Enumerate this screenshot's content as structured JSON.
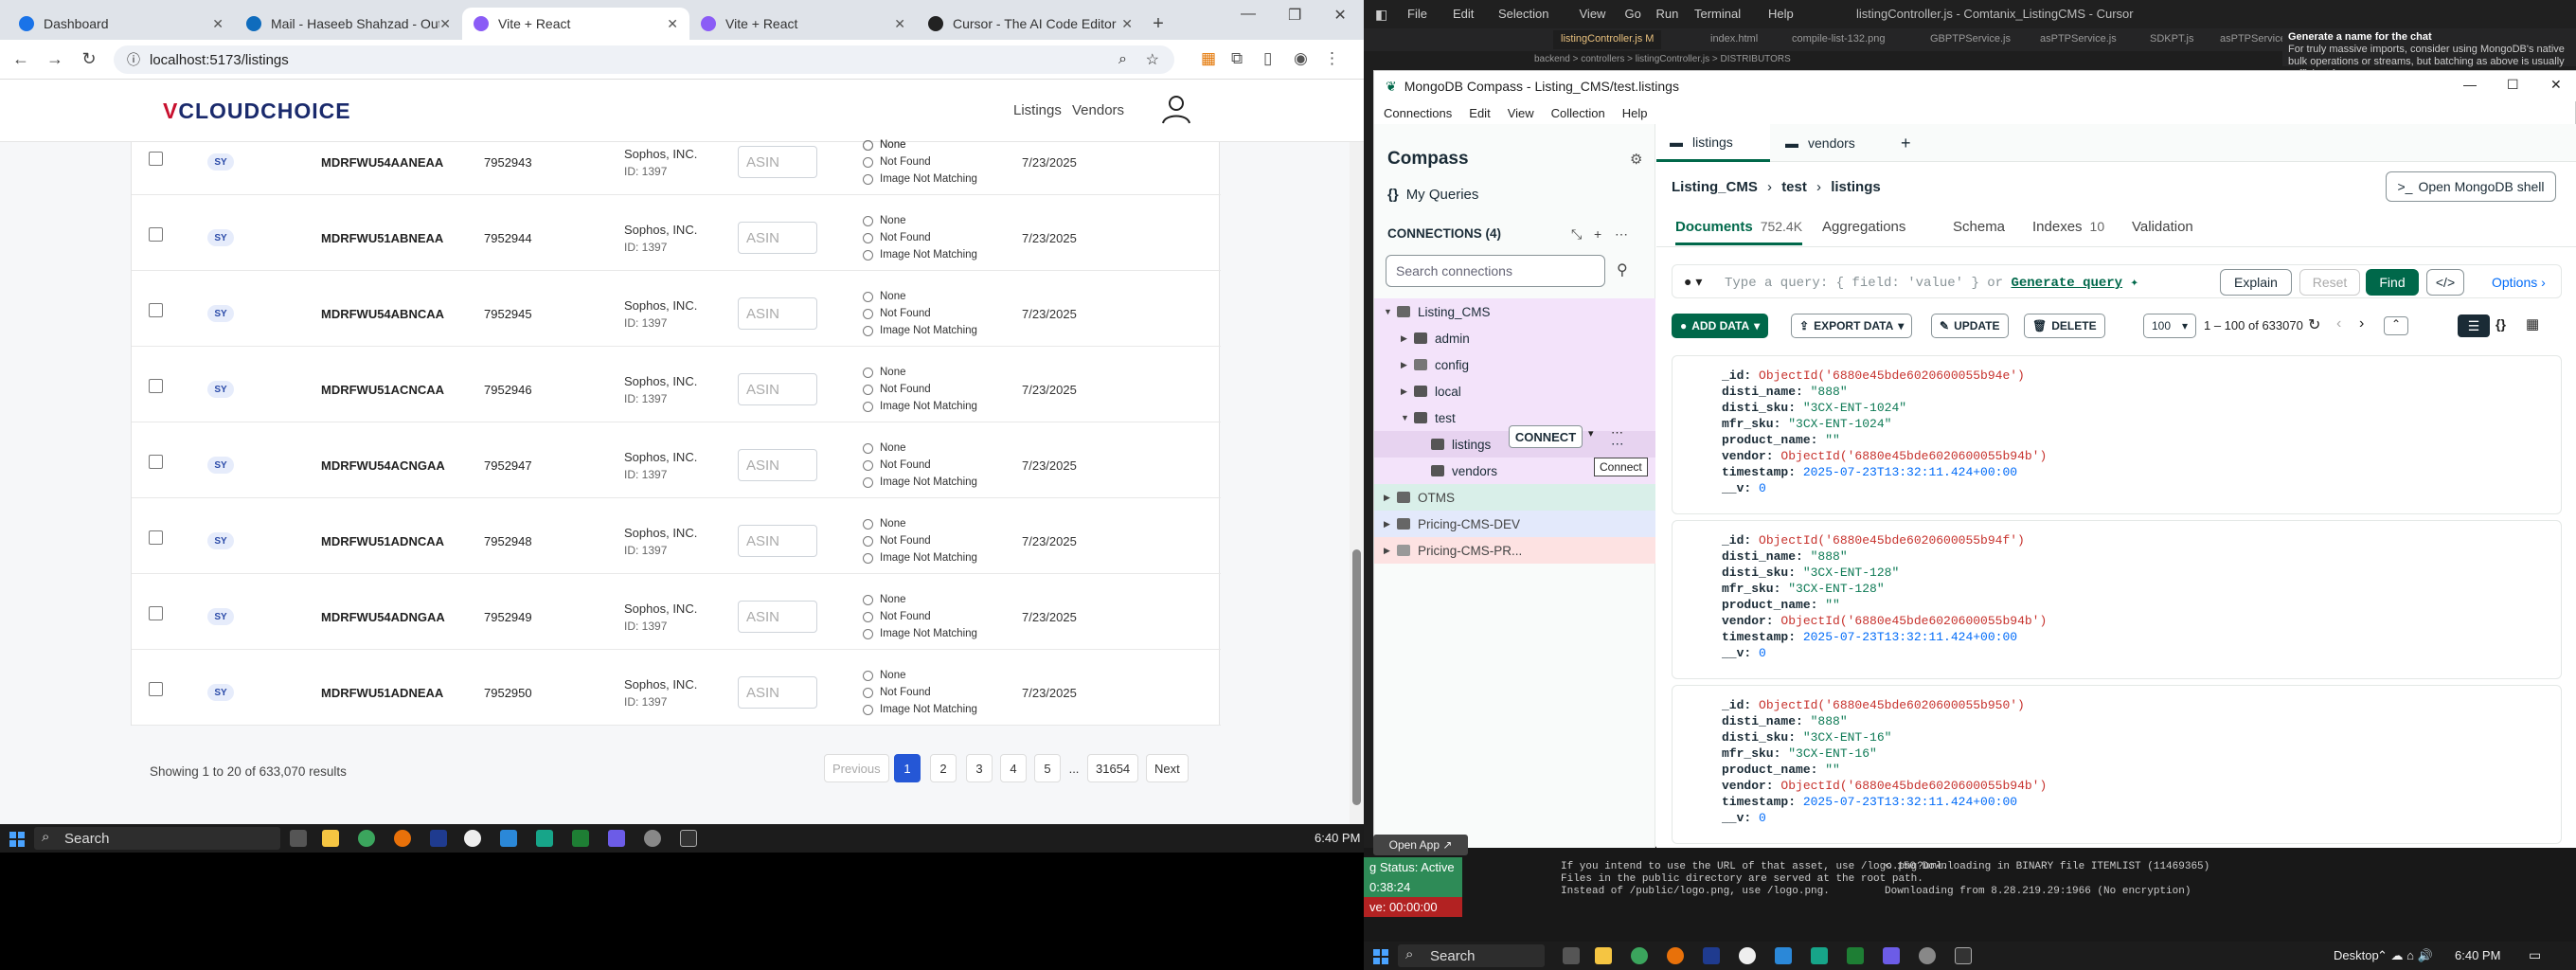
{
  "left_browser": {
    "tabs": [
      {
        "label": "Dashboard",
        "color": "#1a73e8"
      },
      {
        "label": "Mail - Haseeb Shahzad - Outlo",
        "color": "#0f6cbd"
      },
      {
        "label": "Vite + React",
        "color": "#8b5cf6"
      },
      {
        "label": "Vite + React",
        "color": "#8b5cf6"
      },
      {
        "label": "Cursor - The AI Code Editor",
        "color": "#222222"
      }
    ],
    "url": "localhost:5173/listings",
    "app": {
      "logo_prefix": "V",
      "logo_text": "CLOUDCHOICE",
      "nav": [
        "Listings",
        "Vendors"
      ]
    },
    "rows": [
      {
        "badge": "SY",
        "sku": "MDRFWU54AANEAA",
        "id": "7952943",
        "vendor": "Sophos, INC.",
        "vendor_id": "ID: 1397",
        "asin": "ASIN",
        "options": [
          "None",
          "Not Found",
          "Image Not Matching"
        ],
        "date": "7/23/2025"
      },
      {
        "badge": "SY",
        "sku": "MDRFWU51ABNEAA",
        "id": "7952944",
        "vendor": "Sophos, INC.",
        "vendor_id": "ID: 1397",
        "asin": "ASIN",
        "options": [
          "None",
          "Not Found",
          "Image Not Matching"
        ],
        "date": "7/23/2025"
      },
      {
        "badge": "SY",
        "sku": "MDRFWU54ABNCAA",
        "id": "7952945",
        "vendor": "Sophos, INC.",
        "vendor_id": "ID: 1397",
        "asin": "ASIN",
        "options": [
          "None",
          "Not Found",
          "Image Not Matching"
        ],
        "date": "7/23/2025"
      },
      {
        "badge": "SY",
        "sku": "MDRFWU51ACNCAA",
        "id": "7952946",
        "vendor": "Sophos, INC.",
        "vendor_id": "ID: 1397",
        "asin": "ASIN",
        "options": [
          "None",
          "Not Found",
          "Image Not Matching"
        ],
        "date": "7/23/2025"
      },
      {
        "badge": "SY",
        "sku": "MDRFWU54ACNGAA",
        "id": "7952947",
        "vendor": "Sophos, INC.",
        "vendor_id": "ID: 1397",
        "asin": "ASIN",
        "options": [
          "None",
          "Not Found",
          "Image Not Matching"
        ],
        "date": "7/23/2025"
      },
      {
        "badge": "SY",
        "sku": "MDRFWU51ADNCAA",
        "id": "7952948",
        "vendor": "Sophos, INC.",
        "vendor_id": "ID: 1397",
        "asin": "ASIN",
        "options": [
          "None",
          "Not Found",
          "Image Not Matching"
        ],
        "date": "7/23/2025"
      },
      {
        "badge": "SY",
        "sku": "MDRFWU54ADNGAA",
        "id": "7952949",
        "vendor": "Sophos, INC.",
        "vendor_id": "ID: 1397",
        "asin": "ASIN",
        "options": [
          "None",
          "Not Found",
          "Image Not Matching"
        ],
        "date": "7/23/2025"
      },
      {
        "badge": "SY",
        "sku": "MDRFWU51ADNEAA",
        "id": "7952950",
        "vendor": "Sophos, INC.",
        "vendor_id": "ID: 1397",
        "asin": "ASIN",
        "options": [
          "None",
          "Not Found",
          "Image Not Matching"
        ],
        "date": "7/23/2025"
      }
    ],
    "top_partial_option": "None",
    "footer": {
      "results": "Showing 1 to 20 of 633,070 results",
      "pages": [
        "Previous",
        "1",
        "2",
        "3",
        "4",
        "5",
        "...",
        "31654",
        "Next"
      ],
      "current_page": "1"
    },
    "taskbar": {
      "search": "Search",
      "time": "6:40 PM"
    }
  },
  "right": {
    "cursor_title": "listingController.js - Comtanix_ListingCMS - Cursor",
    "cursor_menu": [
      "File",
      "Edit",
      "Selection",
      "View",
      "Go",
      "Run",
      "Terminal",
      "Help"
    ],
    "cursor_tabs": [
      "listingController.js M",
      "index.html",
      "compile-list-132.png",
      "GBPTPService.js",
      "asPTPService.js",
      "SDKPT.js",
      "asPTPService.js"
    ],
    "cursor_breadcrumb": "backend > controllers > listingController.js > DISTRIBUTORS",
    "chat": {
      "title": "Generate a name for the chat",
      "text": "For truly massive imports, consider using MongoDB's native bulk operations or streams, but batching as above is usually sufficient for"
    },
    "compass": {
      "window_title": "MongoDB Compass - Listing_CMS/test.listings",
      "menu": [
        "Connections",
        "Edit",
        "View",
        "Collection",
        "Help"
      ],
      "sidebar": {
        "title": "Compass",
        "my_queries": "My Queries",
        "connections_label": "CONNECTIONS (4)",
        "search_placeholder": "Search connections",
        "tree": [
          {
            "label": "Listing_CMS",
            "level": 0,
            "arrow": "▼",
            "bg": "#f3e3fa",
            "icon": "#666"
          },
          {
            "label": "admin",
            "level": 1,
            "arrow": "▶",
            "bg": "#f3e3fa",
            "icon": "#555"
          },
          {
            "label": "config",
            "level": 1,
            "arrow": "▶",
            "bg": "#f3e3fa",
            "icon": "#777"
          },
          {
            "label": "local",
            "level": 1,
            "arrow": "▶",
            "bg": "#f3e3fa",
            "icon": "#555"
          },
          {
            "label": "test",
            "level": 1,
            "arrow": "▼",
            "bg": "#f3e3fa",
            "icon": "#555"
          },
          {
            "label": "listings",
            "level": 2,
            "arrow": "",
            "bg": "#e7d3f0",
            "icon": "#555"
          },
          {
            "label": "vendors",
            "level": 2,
            "arrow": "",
            "bg": "#f3e3fa",
            "icon": "#555"
          },
          {
            "label": "OTMS",
            "level": 0,
            "arrow": "▶",
            "bg": "#d9efe9",
            "icon": "#666"
          },
          {
            "label": "Pricing-CMS-DEV",
            "level": 0,
            "arrow": "▶",
            "bg": "#e3e9fb",
            "icon": "#666"
          },
          {
            "label": "Pricing-CMS-PR...",
            "level": 0,
            "arrow": "▶",
            "bg": "#fde2e2",
            "icon": "#999"
          }
        ],
        "connect_button": "CONNECT",
        "tooltip": "Connect"
      },
      "tabs": [
        "listings",
        "vendors"
      ],
      "breadcrumb": [
        "Listing_CMS",
        "test",
        "listings"
      ],
      "shell_button": "Open MongoDB shell",
      "subtabs": [
        {
          "label": "Documents",
          "count": "752.4K"
        },
        {
          "label": "Aggregations",
          "count": ""
        },
        {
          "label": "Schema",
          "count": ""
        },
        {
          "label": "Indexes",
          "count": "10"
        },
        {
          "label": "Validation",
          "count": ""
        }
      ],
      "query_placeholder": "Type a query: { field: 'value' } or",
      "generate_query": "Generate query",
      "buttons": {
        "explain": "Explain",
        "reset": "Reset",
        "find": "Find",
        "options": "Options"
      },
      "toolbar": {
        "add": "ADD DATA",
        "export": "EXPORT DATA",
        "update": "UPDATE",
        "delete": "DELETE",
        "page_size": "100",
        "range": "1 – 100 of 633070"
      },
      "documents": [
        {
          "id": "ObjectId('6880e45bde6020600055b94e')",
          "disti_name": "\"888\"",
          "disti_sku": "\"3CX-ENT-1024\"",
          "mfr_sku": "\"3CX-ENT-1024\"",
          "product_name": "\"\"",
          "vendor": "ObjectId('6880e45bde6020600055b94b')",
          "timestamp": "2025-07-23T13:32:11.424+00:00",
          "v": "0"
        },
        {
          "id": "ObjectId('6880e45bde6020600055b94f')",
          "disti_name": "\"888\"",
          "disti_sku": "\"3CX-ENT-128\"",
          "mfr_sku": "\"3CX-ENT-128\"",
          "product_name": "\"\"",
          "vendor": "ObjectId('6880e45bde6020600055b94b')",
          "timestamp": "2025-07-23T13:32:11.424+00:00",
          "v": "0"
        },
        {
          "id": "ObjectId('6880e45bde6020600055b950')",
          "disti_name": "\"888\"",
          "disti_sku": "\"3CX-ENT-16\"",
          "mfr_sku": "\"3CX-ENT-16\"",
          "product_name": "\"\"",
          "vendor": "ObjectId('6880e45bde6020600055b94b')",
          "timestamp": "2025-07-23T13:32:11.424+00:00",
          "v": "0"
        }
      ]
    },
    "open_app": "Open App ↗",
    "status": [
      {
        "label": "g Status: Active",
        "color": "#2e8b57"
      },
      {
        "label": "0:38:24",
        "color": "#2e8b57"
      },
      {
        "label": "ve: 00:00:00",
        "color": "#b22222"
      }
    ],
    "terminal_left": "If you intend to use the URL of that asset, use /logo.png?url.\nFiles in the public directory are served at the root path.\nInstead of /public/logo.png, use /logo.png.",
    "terminal_right": "< 150 Downloading in BINARY file ITEMLIST (11469365)\n\nDownloading from 8.28.219.29:1966 (No encryption)",
    "taskbar": {
      "search": "Search",
      "desktop": "Desktop",
      "time": "6:40 PM"
    }
  }
}
